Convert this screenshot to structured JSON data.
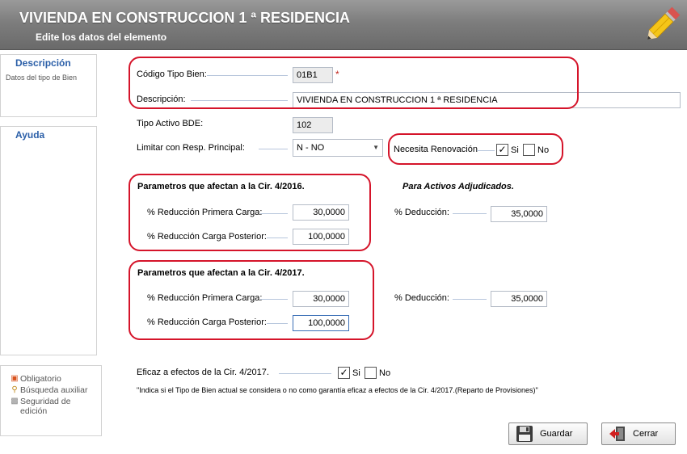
{
  "header": {
    "title": "VIVIENDA EN CONSTRUCCION 1 ª RESIDENCIA",
    "subtitle": "Edite los datos del elemento"
  },
  "sidebar": {
    "descripcion_title": "Descripción",
    "descripcion_text": "Datos del tipo de Bien",
    "ayuda_title": "Ayuda",
    "legend": {
      "obligatorio": "Obligatorio",
      "busqueda": "Búsqueda auxiliar",
      "seguridad": "Seguridad de edición"
    }
  },
  "form": {
    "codigo_label": "Código Tipo Bien:",
    "codigo_value": "01B1",
    "required_mark": "*",
    "descripcion_label": "Descripción:",
    "descripcion_value": "VIVIENDA EN CONSTRUCCION 1 ª RESIDENCIA",
    "tipo_activo_label": "Tipo Activo BDE:",
    "tipo_activo_value": "102",
    "limitar_label": "Limitar con Resp. Principal:",
    "limitar_value": "N - NO",
    "renovacion_label": "Necesita Renovación",
    "renovacion_si": "Si",
    "renovacion_no": "No",
    "renovacion_checked": "si"
  },
  "cir2016": {
    "title": "Parametros que afectan a la Cir. 4/2016.",
    "primera_label": "% Reducción Primera Carga:",
    "primera_value": "30,0000",
    "posterior_label": "% Reducción Carga Posterior:",
    "posterior_value": "100,0000"
  },
  "adjudicados": {
    "title": "Para Activos Adjudicados.",
    "deduccion_label": "% Deducción:",
    "deduccion_value": "35,0000"
  },
  "cir2017": {
    "title": "Parametros que afectan a la Cir. 4/2017.",
    "primera_label": "% Reducción Primera Carga:",
    "primera_value": "30,0000",
    "posterior_label": "% Reducción Carga Posterior:",
    "posterior_value": "100,0000",
    "deduccion_label": "% Deducción:",
    "deduccion_value": "35,0000"
  },
  "eficaz": {
    "label": "Eficaz a efectos de la Cir. 4/2017.",
    "si": "Si",
    "no": "No",
    "checked": "si",
    "note": "\"Indica si el Tipo de Bien actual se considera o no como garantía eficaz a efectos de la Cir. 4/2017.(Reparto de Provisiones)\""
  },
  "buttons": {
    "guardar": "Guardar",
    "cerrar": "Cerrar"
  },
  "colors": {
    "accent": "#2b5fa8",
    "highlight_border": "#d5142a"
  },
  "icons": [
    "pencil-icon",
    "floppy-disk-icon",
    "exit-door-icon",
    "required-icon",
    "search-icon",
    "lock-icon",
    "checkmark-icon",
    "dropdown-arrow-icon"
  ]
}
